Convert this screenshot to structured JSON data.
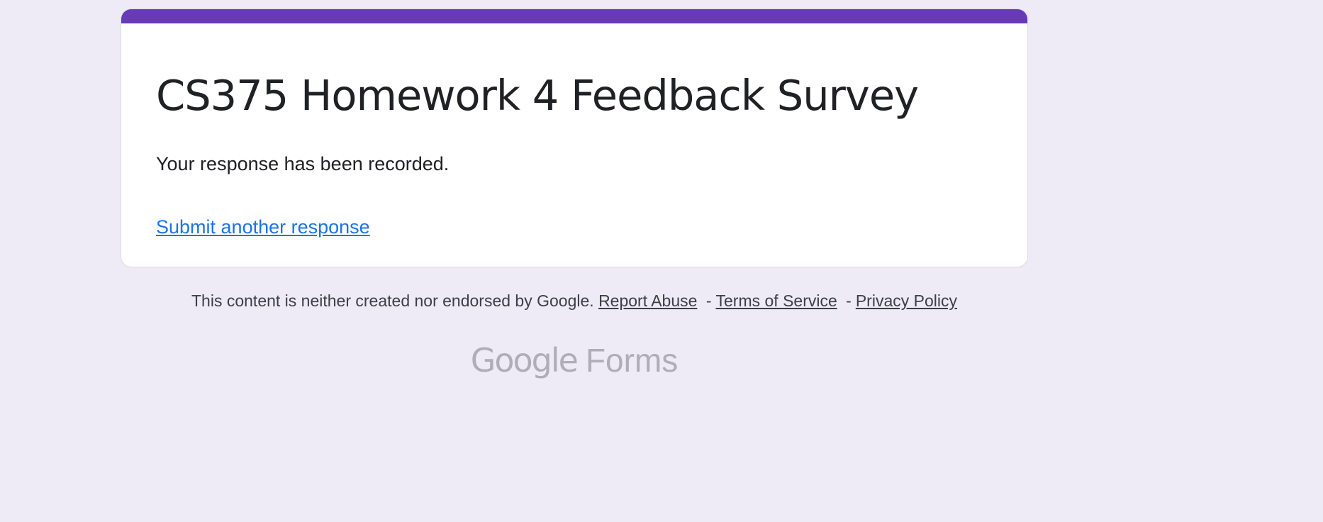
{
  "form": {
    "title": "CS375 Homework 4 Feedback Survey",
    "confirmation": "Your response has been recorded.",
    "submit_another": "Submit another response"
  },
  "footer": {
    "disclaimer": "This content is neither created nor endorsed by Google.",
    "report_abuse": "Report Abuse",
    "separator": "-",
    "terms": "Terms of Service",
    "privacy": "Privacy Policy"
  },
  "brand": {
    "google": "Google",
    "product": "Forms"
  },
  "colors": {
    "accent": "#673ab7",
    "background": "#eeebf7",
    "link": "#1a73e8"
  }
}
